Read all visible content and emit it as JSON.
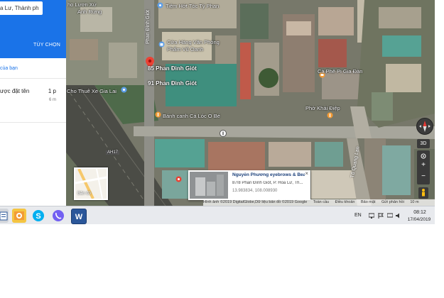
{
  "side_panel": {
    "search_value": "a Lư, Thành ph",
    "options_label": "TÙY CHỌN",
    "your_places_link": "của bạn",
    "route_name": "ược đặt tên",
    "route_duration": "1 p",
    "route_distance": "6 m"
  },
  "map": {
    "labels": {
      "top_left_1": "ho Lươn Xứ",
      "top_left_2": "Anh Rứng",
      "street_vertical": "Phan Đình Giót",
      "barber": "Tiệm Hớt Tóc Tý Phan",
      "stationery_1": "Cửa Hàng Văn Phòng",
      "stationery_2": "Phẩm Vũ Oanh",
      "address_85": "85 Phan Đình Giót",
      "address_91": "91 Phan Đình Giót",
      "car_rental": "Cho Thuê Xe Gia Lai",
      "noodle": "Bánh canh Cá Lóc O Bé",
      "cafe": "Cà Phê Pi Gia Đàn",
      "pho": "Phở Khải Điệp",
      "highway": "AH17",
      "street_right": "Tô Quang Lan"
    },
    "minimap_label": "Bản đồ",
    "btn_3d": "3D",
    "zoom_in": "+",
    "zoom_out": "−",
    "info_card": {
      "title": "Nguyễn Phương eyebrows & Beau...",
      "address": "87/8 Phan Đình Giót, P. Hoa Lư, Th...",
      "coords": "13.983834, 108.008930",
      "close": "×"
    },
    "attribution": {
      "imagery": "Hình ảnh ©2019 DigitalGlobe,Dữ liệu bản đồ ©2019 Google",
      "country": "Toàn cầu",
      "terms": "Điều khoản",
      "privacy": "Bảo mật",
      "feedback": "Gửi phản hồi",
      "scale": "10 m"
    }
  },
  "taskbar": {
    "apps": [
      "file-explorer-icon",
      "photos-icon",
      "skype-icon",
      "viber-icon",
      "word-icon"
    ],
    "word_letter": "W",
    "skype_letter": "S",
    "language": "EN",
    "time": "08:12",
    "date": "17/04/2019"
  },
  "colors": {
    "accent_blue": "#1a73e8",
    "pin_red": "#ea4335",
    "place_orange": "#f29b36"
  }
}
